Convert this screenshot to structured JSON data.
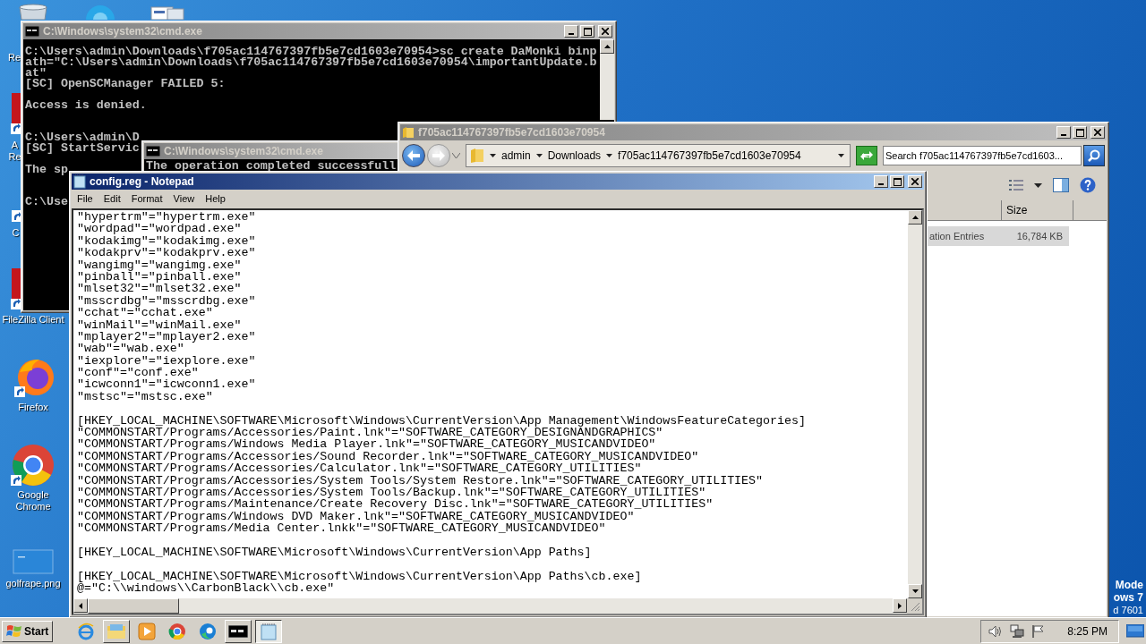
{
  "desktop": {
    "icons": [
      {
        "kind": "recycle-bin",
        "label": "Re"
      },
      {
        "kind": "blue-app"
      },
      {
        "kind": "document"
      },
      {
        "kind": "red-app",
        "label": "A Re"
      },
      {
        "kind": "shortcut",
        "label": "C"
      },
      {
        "kind": "red-app",
        "label": "FileZilla Client"
      },
      {
        "kind": "firefox",
        "label": "Firefox"
      },
      {
        "kind": "chrome",
        "label": "Google Chrome"
      },
      {
        "kind": "image-file",
        "label": "golfrape.png"
      }
    ],
    "edition_notice": [
      "Mode",
      "ows 7",
      "d 7601"
    ]
  },
  "console_back": {
    "title": "C:\\Windows\\system32\\cmd.exe",
    "active": false,
    "blocks": [
      {
        "lines": [
          "C:\\Users\\admin\\Downloads\\f705ac114767397fb5e7cd1603e70954>sc create DaMonki binp",
          "ath=\"C:\\Users\\admin\\Downloads\\f705ac114767397fb5e7cd1603e70954\\importantUpdate.b",
          "at\"",
          "[SC] OpenSCManager FAILED 5:"
        ]
      },
      {
        "lines": [
          "Access is denied."
        ],
        "wide_gap": false
      },
      {
        "lines": [
          "C:\\Users\\admin\\D",
          "[SC] StartServic"
        ],
        "wide_gap": true
      },
      {
        "lines": [
          "The sp"
        ],
        "wide_gap": false
      },
      {
        "lines": [
          "C:\\Use"
        ],
        "wide_gap": true
      }
    ]
  },
  "console_front": {
    "title": "C:\\Windows\\system32\\cmd.exe",
    "active": false,
    "lines": [
      "The operation completed successfull"
    ]
  },
  "explorer": {
    "title": "f705ac114767397fb5e7cd1603e70954",
    "active": false,
    "breadcrumb": [
      "admin",
      "Downloads",
      "f705ac114767397fb5e7cd1603e70954"
    ],
    "search": {
      "placeholder": "Search f705ac114767397fb5e7cd1603..."
    },
    "columns": [
      "Size"
    ],
    "rows": [
      {
        "name": "ation Entries",
        "size": "16,784 KB",
        "selected": true
      }
    ]
  },
  "notepad": {
    "title": "config.reg - Notepad",
    "active": true,
    "menu": [
      "File",
      "Edit",
      "Format",
      "View",
      "Help"
    ],
    "blocks": [
      [
        "\"hypertrm\"=\"hypertrm.exe\"",
        "\"wordpad\"=\"wordpad.exe\"",
        "\"kodakimg\"=\"kodakimg.exe\"",
        "\"kodakprv\"=\"kodakprv.exe\"",
        "\"wangimg\"=\"wangimg.exe\"",
        "\"pinball\"=\"pinball.exe\"",
        "\"mlset32\"=\"mlset32.exe\"",
        "\"msscrdbg\"=\"msscrdbg.exe\"",
        "\"cchat\"=\"cchat.exe\"",
        "\"winMail\"=\"winMail.exe\"",
        "\"mplayer2\"=\"mplayer2.exe\"",
        "\"wab\"=\"wab.exe\"",
        "\"iexplore\"=\"iexplore.exe\"",
        "\"conf\"=\"conf.exe\"",
        "\"icwconn1\"=\"icwconn1.exe\"",
        "\"mstsc\"=\"mstsc.exe\""
      ],
      [
        "[HKEY_LOCAL_MACHINE\\SOFTWARE\\Microsoft\\Windows\\CurrentVersion\\App Management\\WindowsFeatureCategories]",
        "\"COMMONSTART/Programs/Accessories/Paint.lnk\"=\"SOFTWARE_CATEGORY_DESIGNANDGRAPHICS\"",
        "\"COMMONSTART/Programs/Windows Media Player.lnk\"=\"SOFTWARE_CATEGORY_MUSICANDVIDEO\"",
        "\"COMMONSTART/Programs/Accessories/Sound Recorder.lnk\"=\"SOFTWARE_CATEGORY_MUSICANDVIDEO\"",
        "\"COMMONSTART/Programs/Accessories/Calculator.lnk\"=\"SOFTWARE_CATEGORY_UTILITIES\"",
        "\"COMMONSTART/Programs/Accessories/System Tools/System Restore.lnk\"=\"SOFTWARE_CATEGORY_UTILITIES\"",
        "\"COMMONSTART/Programs/Accessories/System Tools/Backup.lnk\"=\"SOFTWARE_CATEGORY_UTILITIES\"",
        "\"COMMONSTART/Programs/Maintenance/Create Recovery Disc.lnk\"=\"SOFTWARE_CATEGORY_UTILITIES\"",
        "\"COMMONSTART/Programs/Windows DVD Maker.lnk\"=\"SOFTWARE_CATEGORY_MUSICANDVIDEO\"",
        "\"COMMONSTART/Programs/Media Center.lnkk\"=\"SOFTWARE_CATEGORY_MUSICANDVIDEO\""
      ],
      [
        "[HKEY_LOCAL_MACHINE\\SOFTWARE\\Microsoft\\Windows\\CurrentVersion\\App Paths]"
      ],
      [
        "[HKEY_LOCAL_MACHINE\\SOFTWARE\\Microsoft\\Windows\\CurrentVersion\\App Paths\\cb.exe]",
        "@=\"C:\\\\windows\\\\CarbonBlack\\\\cb.exe\""
      ]
    ]
  },
  "taskbar": {
    "start": "Start",
    "apps": [
      {
        "kind": "browser-e",
        "running": false,
        "selected": false
      },
      {
        "kind": "folder",
        "running": true,
        "selected": false
      },
      {
        "kind": "media",
        "running": false,
        "selected": false
      },
      {
        "kind": "chrome",
        "running": false,
        "selected": false
      },
      {
        "kind": "edge",
        "running": false,
        "selected": false
      },
      {
        "kind": "console",
        "running": true,
        "selected": false
      },
      {
        "kind": "notepad",
        "running": true,
        "selected": true
      }
    ],
    "clock": "8:25 PM"
  }
}
